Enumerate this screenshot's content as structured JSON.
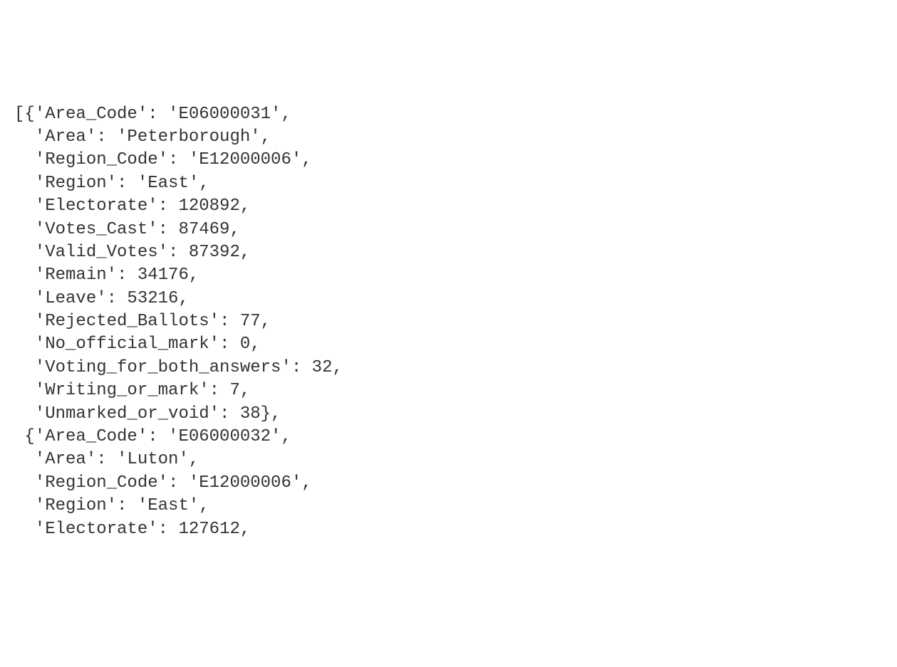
{
  "lines": [
    {
      "text": "[{'Area_Code': 'E06000031',"
    },
    {
      "text": "  'Area': 'Peterborough',"
    },
    {
      "text": "  'Region_Code': 'E12000006',"
    },
    {
      "text": "  'Region': 'East',"
    },
    {
      "text": "  'Electorate': 120892,"
    },
    {
      "text": "  'Votes_Cast': 87469,"
    },
    {
      "text": "  'Valid_Votes': 87392,"
    },
    {
      "text": "  'Remain': 34176,"
    },
    {
      "text": "  'Leave': 53216,"
    },
    {
      "text": "  'Rejected_Ballots': 77,"
    },
    {
      "text": "  'No_official_mark': 0,"
    },
    {
      "text": "  'Voting_for_both_answers': 32,"
    },
    {
      "text": "  'Writing_or_mark': 7,"
    },
    {
      "text": "  'Unmarked_or_void': 38},"
    },
    {
      "text": " {'Area_Code': 'E06000032',"
    },
    {
      "text": "  'Area': 'Luton',"
    },
    {
      "text": "  'Region_Code': 'E12000006',"
    },
    {
      "text": "  'Region': 'East',"
    },
    {
      "text": "  'Electorate': 127612,"
    }
  ],
  "data_records": [
    {
      "Area_Code": "E06000031",
      "Area": "Peterborough",
      "Region_Code": "E12000006",
      "Region": "East",
      "Electorate": 120892,
      "Votes_Cast": 87469,
      "Valid_Votes": 87392,
      "Remain": 34176,
      "Leave": 53216,
      "Rejected_Ballots": 77,
      "No_official_mark": 0,
      "Voting_for_both_answers": 32,
      "Writing_or_mark": 7,
      "Unmarked_or_void": 38
    },
    {
      "Area_Code": "E06000032",
      "Area": "Luton",
      "Region_Code": "E12000006",
      "Region": "East",
      "Electorate": 127612
    }
  ]
}
